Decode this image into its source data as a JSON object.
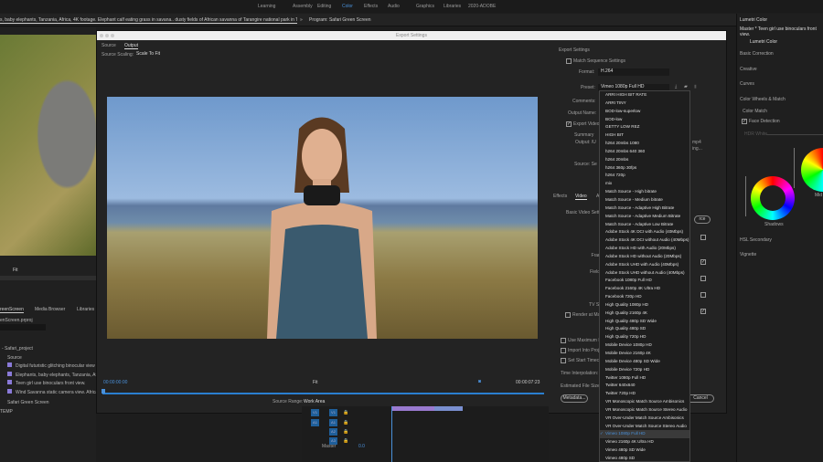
{
  "workspaces": [
    "Learning",
    "Assembly",
    "Editing",
    "Color",
    "Effects",
    "Audio",
    "Graphics",
    "Libraries",
    "2020-ADOBE"
  ],
  "active_workspace": "Color",
  "source_panel_title": "s, baby elephants, Tanzania, Africa, 4K footage. Elephant calf eating grass in savana.. dusty fields of African savanna of Tarangire national park in Tanzania, An elephant walks with its baby",
  "program_title": "Program: Safari Green Screen",
  "left": {
    "fit": "Fit",
    "tabs": [
      "reenScreen",
      "Media Browser",
      "Libraries"
    ],
    "project_file": "enScreen.prproj",
    "project_name": "- Safari_project",
    "folder": "Source",
    "items": [
      "Digital futuristic glitching binocular view ove",
      "Elephants, baby elephants, Tanzania, Africa, 4",
      "Teen girl use binoculars front view.",
      "Wind Savanna static camera view. Africa. Tan"
    ],
    "sequence": "Safari Green Screen",
    "footer": "TEMP"
  },
  "dialog": {
    "title": "Export Settings",
    "tabs": [
      "Source",
      "Output"
    ],
    "source_scaling_label": "Source Scaling:",
    "source_scaling": "Scale To Fit",
    "timecode_start": "00:00:00:00",
    "timecode_end": "00:00:07:23",
    "fit": "Fit",
    "source_range_label": "Source Range:",
    "source_range": "Work Area",
    "export_settings": "Export Settings",
    "match_sequence": "Match Sequence Settings",
    "format_label": "Format:",
    "format": "H.264",
    "preset_label": "Preset:",
    "preset": "Vimeo 1080p Full HD",
    "comments_label": "Comments:",
    "output_name_label": "Output Name:",
    "export_video": "Export Video",
    "summary": "Summary",
    "output_label": "Output: /U",
    "source_label": "Source: Se",
    "output_tail": "mp4",
    "output_tail2": "ing...",
    "panel_tabs": [
      "Effects",
      "Video",
      "A"
    ],
    "basic_video": "Basic Video Setti",
    "render_max": "Render at Maxim",
    "use_max": "Use Maximum Ren",
    "import_project": "Import Into Project",
    "start_tc": "Set Start Timecode",
    "time_interp": "Time Interpolation:",
    "file_size": "Estimated File Size:",
    "metadata": "Metadata...",
    "cancel": "Cancel",
    "match_source_btn": "rce",
    "side_labels": [
      "V",
      "In",
      "Frame",
      "Field C",
      "As",
      "TV Star"
    ]
  },
  "preset_options": [
    "ARRI HIGH BIT RATE",
    "ARRI TINY",
    "BOD-low-superlow",
    "BOD-low",
    "GETTY LOW REZ",
    "HIGH BIT",
    "h264 20mbs 1080",
    "h264 20mbs 640 360",
    "h264 20mbs",
    "h264 360p 30fps",
    "h264 720p",
    "mix",
    "Match Source - High bitrate",
    "Match Source - Medium bitrate",
    "Match Source - Adaptive High Bitrate",
    "Match Source - Adaptive Medium Bitrate",
    "Match Source - Adaptive Low Bitrate",
    "Adobe Stock 4K DCI with Audio (40Mbps)",
    "Adobe Stock 4K DCI without Audio (40Mbps)",
    "Adobe Stock HD with Audio (20Mbps)",
    "Adobe Stock HD without Audio (20Mbps)",
    "Adobe Stock UHD with Audio (40Mbps)",
    "Adobe Stock UHD without Audio (40Mbps)",
    "Facebook 1080p Full HD",
    "Facebook 2160p 4K Ultra HD",
    "Facebook 720p HD",
    "High Quality 1080p HD",
    "High Quality 2160p 4K",
    "High Quality 480p SD Wide",
    "High Quality 480p SD",
    "High Quality 720p HD",
    "Mobile Device 1080p HD",
    "Mobile Device 2160p 4K",
    "Mobile Device 480p SD Wide",
    "Mobile Device 720p HD",
    "Twitter 1080p Full HD",
    "Twitter 640x640",
    "Twitter 720p HD",
    "VR Monoscopic Match Source Ambisonics",
    "VR Monoscopic Match Source Stereo Audio",
    "VR Over-Under Match Source Ambisonics",
    "VR Over-Under Match Source Stereo Audio",
    "Vimeo 1080p Full HD",
    "Vimeo 2160p 4K Ultra HD",
    "Vimeo 480p SD Wide",
    "Vimeo 480p SD"
  ],
  "selected_preset_index": 42,
  "lumetri": {
    "title": "Lumetri Color",
    "master": "Master * Teen girl use binoculars front view.",
    "fx": "Lumetri Color",
    "sections": [
      "Basic Correction",
      "Creative",
      "Curves",
      "Color Wheels & Match"
    ],
    "color_match": "Color Match",
    "face_detection": "Face Detection",
    "hdr_white": "HDR White",
    "shadows": "Shadows",
    "midtones": "Mid",
    "hsl": "HSL Secondary",
    "vignette": "Vignette"
  },
  "timeline": {
    "tracks": [
      "V1",
      "A1",
      "A2",
      "A3"
    ],
    "src": [
      "V1",
      "A1"
    ],
    "master": "Master",
    "master_val": "0.0"
  }
}
